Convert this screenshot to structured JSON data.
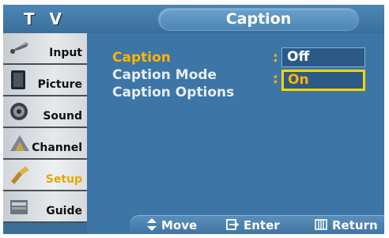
{
  "header": {
    "system_title": "T V",
    "page_title": "Caption"
  },
  "sidebar": {
    "items": [
      {
        "label": "Input",
        "icon": "input-plug-icon",
        "active": false
      },
      {
        "label": "Picture",
        "icon": "picture-monitor-icon",
        "active": false
      },
      {
        "label": "Sound",
        "icon": "speaker-icon",
        "active": false
      },
      {
        "label": "Channel",
        "icon": "channel-antenna-icon",
        "active": false
      },
      {
        "label": "Setup",
        "icon": "setup-icon",
        "active": true
      },
      {
        "label": "Guide",
        "icon": "program-guide-icon",
        "active": false
      }
    ]
  },
  "menu": {
    "rows": [
      {
        "label": "Caption"
      },
      {
        "label": "Caption Mode"
      },
      {
        "label": "Caption Options"
      }
    ],
    "colon": ":",
    "option_off": "Off",
    "option_on": "On"
  },
  "footer": {
    "move": "Move",
    "enter": "Enter",
    "return": "Return"
  },
  "colors": {
    "background": "#3d76a6",
    "accent": "#ffb400",
    "selection_border": "#ffd200"
  }
}
